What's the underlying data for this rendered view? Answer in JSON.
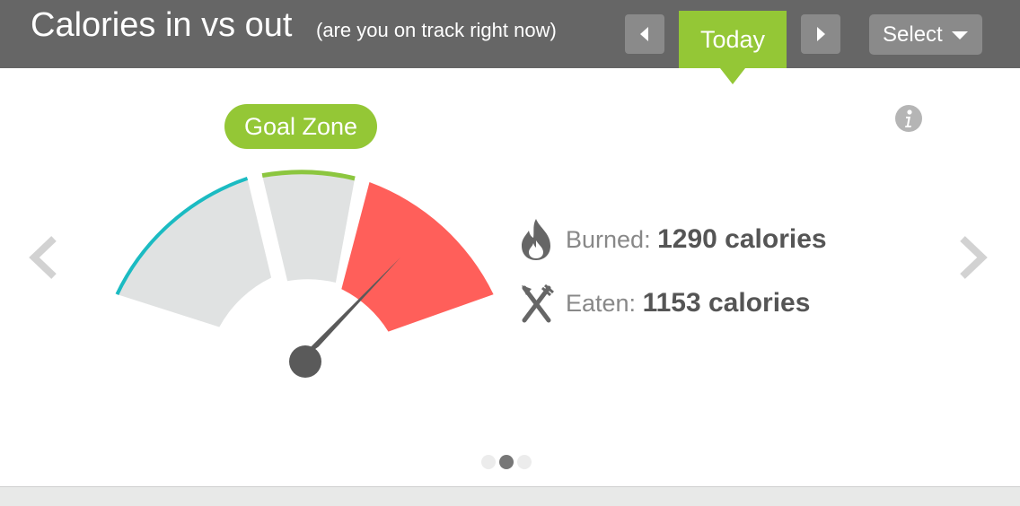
{
  "header": {
    "title": "Calories in vs out",
    "subtitle": "(are you on track right now)",
    "prev_icon": "caret-left-icon",
    "next_icon": "caret-right-icon",
    "today_label": "Today",
    "select_label": "Select",
    "select_icon": "caret-down-icon"
  },
  "gauge": {
    "goal_zone_label": "Goal Zone",
    "needle_icon": "gauge-needle"
  },
  "stats": {
    "burned": {
      "icon": "flame-icon",
      "label": "Burned:",
      "value": "1290 calories"
    },
    "eaten": {
      "icon": "fork-knife-icon",
      "label": "Eaten:",
      "value": "1153 calories"
    }
  },
  "pagination": {
    "count": 3,
    "active_index": 1
  },
  "colors": {
    "header_bg": "#666666",
    "accent_green": "#94c736",
    "danger_red": "#ff5f5a",
    "low_teal": "#1bbbc2",
    "gauge_gray": "#e0e2e2",
    "needle": "#5a5a5a"
  }
}
